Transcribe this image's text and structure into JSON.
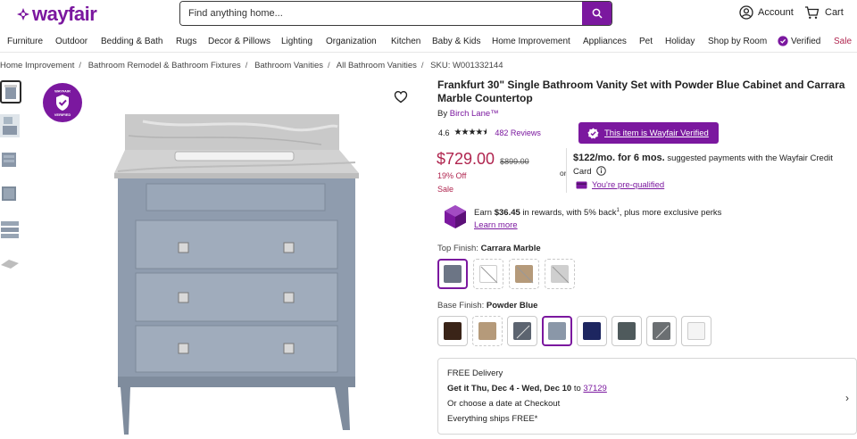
{
  "header": {
    "logo": "wayfair",
    "search_placeholder": "Find anything home...",
    "account_label": "Account",
    "cart_label": "Cart"
  },
  "nav": {
    "items": [
      "Furniture",
      "Outdoor",
      "Bedding & Bath",
      "Rugs",
      "Decor & Pillows",
      "Lighting",
      "Organization",
      "Kitchen",
      "Baby & Kids",
      "Home Improvement",
      "Appliances",
      "Pet",
      "Holiday",
      "Shop by Room",
      "Verified",
      "Sale"
    ]
  },
  "breadcrumb": {
    "items": [
      "Home Improvement",
      "Bathroom Remodel & Bathroom Fixtures",
      "Bathroom Vanities",
      "All Bathroom Vanities"
    ],
    "sku": "SKU: W001332144"
  },
  "gallery": {
    "badge_text": "WAYFAIR VERIFIED"
  },
  "product": {
    "title": "Frankfurt 30\" Single Bathroom Vanity Set with Powder Blue Cabinet and Carrara Marble Countertop",
    "by": "By",
    "brand": "Birch Lane™",
    "rating": "4.6",
    "rating_stars": 4.6,
    "reviews": "482 Reviews",
    "verified_label": "This item is Wayfair Verified"
  },
  "pricing": {
    "price": "$729.00",
    "was": "$899.00",
    "discount": "19% Off",
    "sale": "Sale",
    "or": "or",
    "monthly_bold": "$122/mo. for 6 mos.",
    "monthly_rest": "suggested payments with the Wayfair Credit Card",
    "prequal": "You're pre-qualified"
  },
  "rewards": {
    "earn": "Earn",
    "amount": "$36.45",
    "text_a": "in rewards, with 5% back",
    "sup": "1",
    "text_b": ", plus more exclusive perks",
    "learn_more": "Learn more"
  },
  "top_finish": {
    "label": "Top Finish:",
    "value": "Carrara Marble",
    "colors": [
      "#6c7585",
      "#ffffff",
      "#b59a7a",
      "#cfcfcf"
    ]
  },
  "base_finish": {
    "label": "Base Finish:",
    "value": "Powder Blue",
    "colors": [
      "#3a2418",
      "#b59a7a",
      "#5c6470",
      "#8a97a8",
      "#1d2660",
      "#4f5a5c",
      "#6b6f72",
      "#f4f4f4"
    ]
  },
  "delivery": {
    "line1": "FREE Delivery",
    "get_it": "Get it Thu, Dec 4 - Wed, Dec 10",
    "to": "to",
    "zip": "37129",
    "line3": "Or choose a date at Checkout",
    "line4": "Everything ships FREE*"
  }
}
